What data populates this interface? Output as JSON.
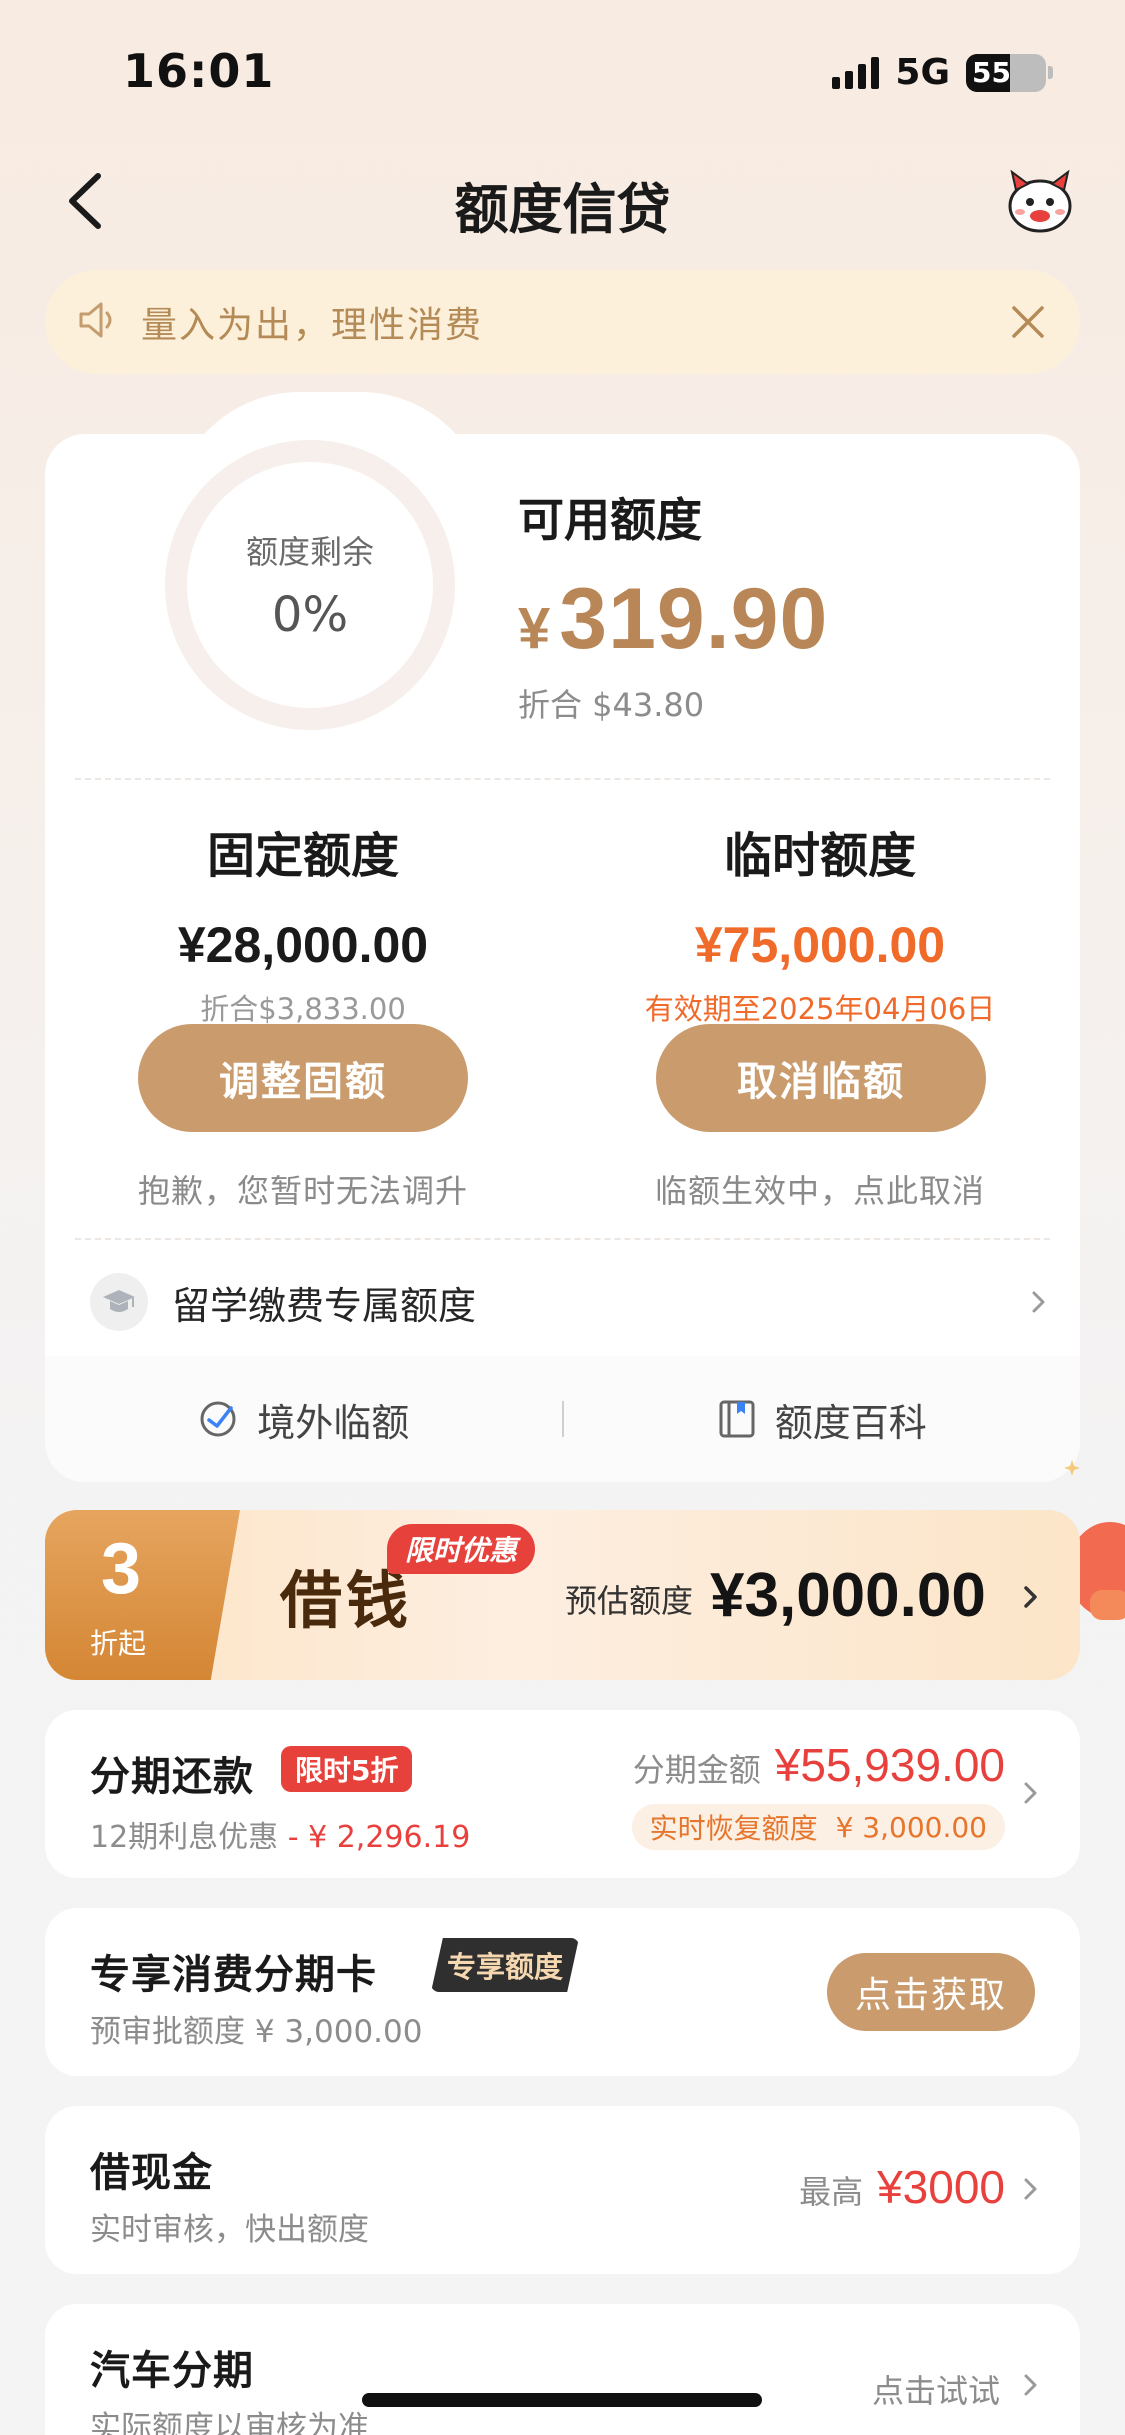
{
  "status_bar": {
    "time": "16:01",
    "network": "5G",
    "battery": "55"
  },
  "nav": {
    "title": "额度信贷",
    "back_icon": "chevron-left-icon",
    "mascot_icon": "mascot-icon"
  },
  "notice": {
    "text": "量入为出，理性消费"
  },
  "quota": {
    "ring_label": "额度剩余",
    "ring_value": "0%",
    "available_title": "可用额度",
    "available_currency": "¥",
    "available_amount": "319.90",
    "available_converted": "折合 $43.80",
    "fixed": {
      "title": "固定额度",
      "amount": "¥28,000.00",
      "converted": "折合$3,833.00",
      "button": "调整固额",
      "note": "抱歉，您暂时无法调升"
    },
    "temporary": {
      "title": "临时额度",
      "amount": "¥75,000.00",
      "validity": "有效期至2025年04月06日",
      "button": "取消临额",
      "note": "临额生效中，点此取消"
    },
    "study_label": "留学缴费专属额度",
    "footer": {
      "overseas": "境外临额",
      "wiki": "额度百科"
    }
  },
  "loan_banner": {
    "badge_number": "3",
    "badge_text": "折起",
    "title": "借钱",
    "tag": "限时优惠",
    "estimate_label": "预估额度",
    "estimate_amount": "¥3,000.00"
  },
  "installment": {
    "title": "分期还款",
    "tag": "限时5折",
    "discount_label": "12期利息优惠",
    "discount_amount": "- ¥ 2,296.19",
    "amount_label": "分期金额",
    "amount": "¥55,939.00",
    "restore_label": "实时恢复额度",
    "restore_amount": "¥ 3,000.00"
  },
  "card_offer": {
    "title": "专享消费分期卡",
    "tag": "专享额度",
    "sub": "预审批额度 ¥ 3,000.00",
    "button": "点击获取"
  },
  "cash_loan": {
    "title": "借现金",
    "sub": "实时审核，快出额度",
    "max_label": "最高",
    "max_amount": "¥3000"
  },
  "car_loan": {
    "title": "汽车分期",
    "sub": "实际额度以审核为准",
    "action": "点击试试"
  },
  "colors": {
    "accent": "#c99b6d",
    "gold_text": "#b98757",
    "red": "#e8413d",
    "orange": "#f06a2a"
  }
}
